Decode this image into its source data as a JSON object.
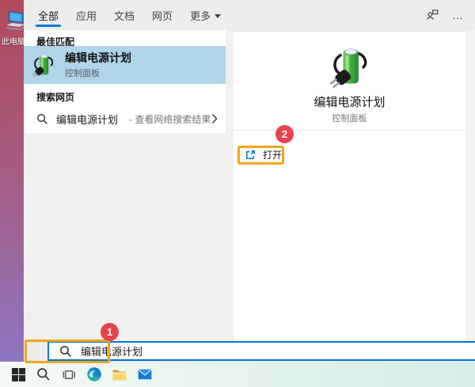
{
  "colors": {
    "accent": "#0078d7",
    "best_match_highlight": "#b0d4e8",
    "annotation_orange": "#f2a51c",
    "badge_red": "#e8434c",
    "battery_green": "#43a047"
  },
  "desktop": {
    "icon_label": "此电脑"
  },
  "tabs": {
    "items": [
      {
        "label": "全部",
        "active": true
      },
      {
        "label": "应用",
        "active": false
      },
      {
        "label": "文档",
        "active": false
      },
      {
        "label": "网页",
        "active": false
      },
      {
        "label": "更多",
        "active": false,
        "has_dropdown": true
      }
    ],
    "more_icon": "…"
  },
  "results": {
    "best_match_header": "最佳匹配",
    "best_match": {
      "title": "编辑电源计划",
      "subtitle": "控制面板"
    },
    "search_web_header": "搜索网页",
    "web_item": {
      "query": "编辑电源计划",
      "hint": "- 查看网络搜索结果"
    }
  },
  "preview": {
    "title": "编辑电源计划",
    "subtitle": "控制面板",
    "open_label": "打开"
  },
  "search_box": {
    "value": "编辑电源计划"
  },
  "annotations": {
    "step1": "1",
    "step2": "2"
  },
  "taskbar_icons": [
    "windows-start",
    "search",
    "task-view",
    "edge-browser",
    "file-explorer",
    "mail"
  ]
}
